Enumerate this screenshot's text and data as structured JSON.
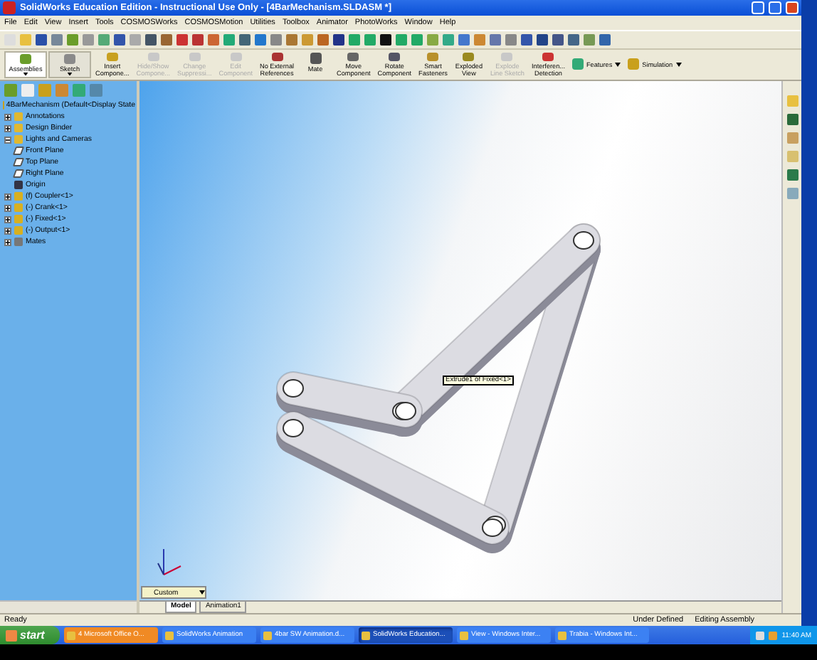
{
  "window": {
    "title": "SolidWorks Education Edition - Instructional Use Only - [4BarMechanism.SLDASM *]"
  },
  "menu": [
    "File",
    "Edit",
    "View",
    "Insert",
    "Tools",
    "COSMOSWorks",
    "COSMOSMotion",
    "Utilities",
    "Toolbox",
    "Animator",
    "PhotoWorks",
    "Window",
    "Help"
  ],
  "commands": [
    {
      "label": "Assemblies",
      "kind": "tab",
      "selected": true,
      "disabled": false
    },
    {
      "label": "Sketch",
      "kind": "tab",
      "selected": false,
      "disabled": false
    },
    {
      "label": "Insert\nCompone...",
      "kind": "button",
      "selected": false,
      "disabled": false
    },
    {
      "label": "Hide/Show\nCompone...",
      "kind": "button",
      "selected": false,
      "disabled": true
    },
    {
      "label": "Change\nSuppressi...",
      "kind": "button",
      "selected": false,
      "disabled": true
    },
    {
      "label": "Edit\nComponent",
      "kind": "button",
      "selected": false,
      "disabled": true
    },
    {
      "label": "No External\nReferences",
      "kind": "button",
      "selected": false,
      "disabled": false
    },
    {
      "label": "Mate",
      "kind": "button",
      "selected": false,
      "disabled": false
    },
    {
      "label": "Move\nComponent",
      "kind": "button",
      "selected": false,
      "disabled": false
    },
    {
      "label": "Rotate\nComponent",
      "kind": "button",
      "selected": false,
      "disabled": false
    },
    {
      "label": "Smart\nFasteners",
      "kind": "button",
      "selected": false,
      "disabled": false
    },
    {
      "label": "Exploded\nView",
      "kind": "button",
      "selected": false,
      "disabled": false
    },
    {
      "label": "Explode\nLine Sketch",
      "kind": "button",
      "selected": false,
      "disabled": true
    },
    {
      "label": "Interferen...\nDetection",
      "kind": "button",
      "selected": false,
      "disabled": false
    },
    {
      "label": "Features",
      "kind": "menu",
      "selected": false,
      "disabled": false
    },
    {
      "label": "Simulation",
      "kind": "menu",
      "selected": false,
      "disabled": false
    }
  ],
  "tree": {
    "root": "4BarMechanism  (Default<Display State",
    "items": [
      {
        "label": "Annotations",
        "kind": "folder",
        "expanded": false
      },
      {
        "label": "Design Binder",
        "kind": "folder",
        "expanded": false
      },
      {
        "label": "Lights and Cameras",
        "kind": "folder",
        "expanded": true
      },
      {
        "label": "Front Plane",
        "kind": "plane"
      },
      {
        "label": "Top Plane",
        "kind": "plane"
      },
      {
        "label": "Right Plane",
        "kind": "plane"
      },
      {
        "label": "Origin",
        "kind": "origin"
      },
      {
        "label": "(f) Coupler<1>",
        "kind": "part",
        "expanded": false
      },
      {
        "label": "(-) Crank<1>",
        "kind": "part",
        "expanded": false
      },
      {
        "label": "(-) Fixed<1>",
        "kind": "part",
        "expanded": false
      },
      {
        "label": "(-) Output<1>",
        "kind": "part",
        "expanded": false
      },
      {
        "label": "Mates",
        "kind": "mates",
        "expanded": false
      }
    ]
  },
  "viewport": {
    "tooltip": "Extrude1 of Fixed<1>",
    "view": "Custom"
  },
  "tabs": [
    {
      "label": "Model",
      "selected": true
    },
    {
      "label": "Animation1",
      "selected": false
    }
  ],
  "status_bar": {
    "message": "Ready",
    "state": "Under Defined",
    "mode": "Editing Assembly"
  },
  "taskbar": {
    "start": "start",
    "clock": "11:40 AM",
    "items": [
      {
        "label": "4 Microsoft Office O...",
        "selected": false,
        "attention": true
      },
      {
        "label": "SolidWorks Animation",
        "selected": false,
        "attention": false
      },
      {
        "label": "4bar SW Animation.d...",
        "selected": false,
        "attention": false
      },
      {
        "label": "SolidWorks Education...",
        "selected": true,
        "attention": false
      },
      {
        "label": "View - Windows Inter...",
        "selected": false,
        "attention": false
      },
      {
        "label": "Trabia - Windows Int...",
        "selected": false,
        "attention": false
      }
    ]
  }
}
